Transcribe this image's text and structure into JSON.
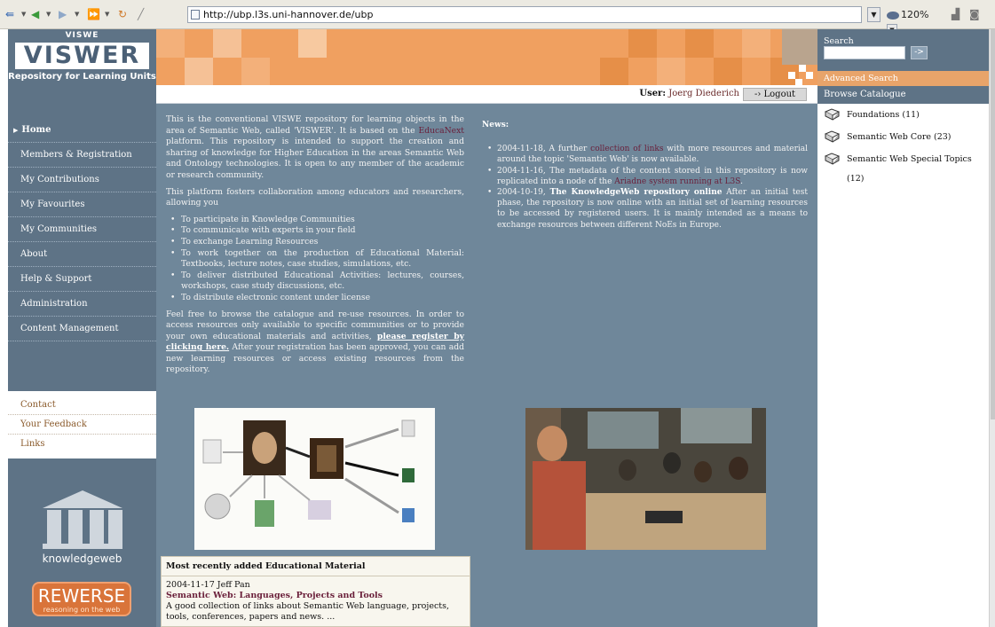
{
  "browser": {
    "url": "http://ubp.l3s.uni-hannover.de/ubp",
    "zoom": "120%"
  },
  "logo": {
    "small": "VISWE",
    "word": "VISWER",
    "subtitle": "Repository for Learning Units"
  },
  "nav": [
    {
      "label": "Home",
      "active": true
    },
    {
      "label": "Members & Registration"
    },
    {
      "label": "My Contributions"
    },
    {
      "label": "My Favourites"
    },
    {
      "label": "My Communities"
    },
    {
      "label": "About"
    },
    {
      "label": "Help & Support"
    },
    {
      "label": "Administration"
    },
    {
      "label": "Content Management"
    }
  ],
  "contact_links": [
    "Contact",
    "Your Feedback",
    "Links"
  ],
  "partners": {
    "knowledgeweb": "knowledgeweb",
    "rewerse": "REWERSE",
    "rewerse_tagline": "reasoning on the web"
  },
  "user": {
    "label": "User:",
    "name": "Joerg Diederich",
    "logout": "Logout"
  },
  "intro": {
    "p1_a": "This is the conventional VISWE repository for learning objects in the area of Semantic Web, called 'VISWER'. It is based on the ",
    "p1_link": "EducaNext",
    "p1_b": " platform. This repository is intended to support the creation and sharing of knowledge for Higher Education in the areas Semantic Web and Ontology technologies. It is open to any member of the academic or research community.",
    "p2": "This platform fosters collaboration among educators and researchers, allowing you",
    "bullets": [
      "To participate in Knowledge Communities",
      "To communicate with experts in your field",
      "To exchange Learning Resources",
      "To work together on the production of Educational Material: Textbooks, lecture notes, case studies, simulations, etc.",
      "To deliver distributed Educational Activities: lectures, courses, workshops, case study discussions, etc.",
      "To distribute electronic content under license"
    ],
    "p3_a": "Feel free to browse the catalogue and re-use resources. In order to access resources only available to specific communities or to provide your own educational materials and activities, ",
    "p3_link": "please register by clicking here.",
    "p3_b": " After your registration has been approved, you can add new learning resources or access existing resources from the repository."
  },
  "news": {
    "title": "News:",
    "items": [
      {
        "a": "2004-11-18, A further ",
        "link": "collection of links",
        "b": " with more resources and material around the topic 'Semantic Web' is now available."
      },
      {
        "a": "2004-11-16, The metadata of the content stored in this repository is now replicated into a node of the ",
        "link": "Ariadne system running at L3S",
        "b": "."
      },
      {
        "a": "2004-10-19, ",
        "bold": "The KnowledgeWeb repository online",
        "b": " After an initial test phase, the repository is now online with an initial set of learning resources to be accessed by registered users. It is mainly intended as a means to exchange resources between different NoEs in Europe."
      }
    ]
  },
  "recent": {
    "heading": "Most recently added Educational Material",
    "meta": "2004-11-17 Jeff Pan",
    "title": "Semantic Web: Languages, Projects and Tools",
    "desc": "A good collection of links about Semantic Web language, projects, tools, conferences, papers and news. ..."
  },
  "search": {
    "label": "Search",
    "button": "->",
    "advanced": "Advanced Search"
  },
  "catalogue": {
    "title": "Browse Catalogue",
    "items": [
      "Foundations (11)",
      "Semantic Web Core (23)",
      "Semantic Web Special Topics (12)"
    ]
  },
  "colors": {
    "sidebar": "#5e7386",
    "content": "#6f879a",
    "accent": "#f0a060",
    "link": "#6a1f3a"
  }
}
